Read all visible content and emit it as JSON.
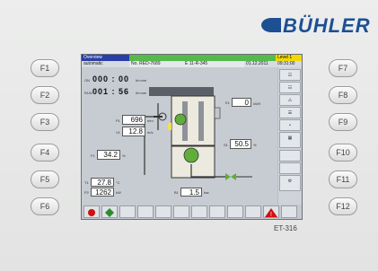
{
  "brand": {
    "name": "BÜHLER",
    "color": "#1d4f93"
  },
  "function_keys": {
    "left": [
      "F1",
      "F2",
      "F3",
      "F4",
      "F5",
      "F6"
    ],
    "right": [
      "F7",
      "F8",
      "F9",
      "F10",
      "F11",
      "F12"
    ]
  },
  "screen": {
    "header": {
      "row1": {
        "mode_label": "Overview",
        "status": "Level 1"
      },
      "row2": {
        "mode": "automatic",
        "recipe": "No. RED-7689",
        "machine": "E 11-R-345",
        "date": "01.12.2011",
        "time": "09:31:00"
      }
    },
    "clocks": {
      "top": "000 : 00",
      "top_unit": "hh:mm",
      "bottom": "001 : 56",
      "bottom_unit": "hh:mm"
    },
    "values": {
      "v1": {
        "value": "696",
        "unit": "mm"
      },
      "v2": {
        "value": "12.8",
        "unit": "m/s"
      },
      "v3": {
        "value": "34.2",
        "unit": "%"
      },
      "v4": {
        "value": "0",
        "unit": "kW/t"
      },
      "v5": {
        "value": "50.5",
        "unit": "%"
      },
      "v6": {
        "value": "27.8",
        "unit": "°C"
      },
      "v7": {
        "value": "1262",
        "unit": "kW"
      },
      "v8": {
        "value": "1.5",
        "unit": "bar"
      }
    }
  },
  "footer_code": "ET-316"
}
